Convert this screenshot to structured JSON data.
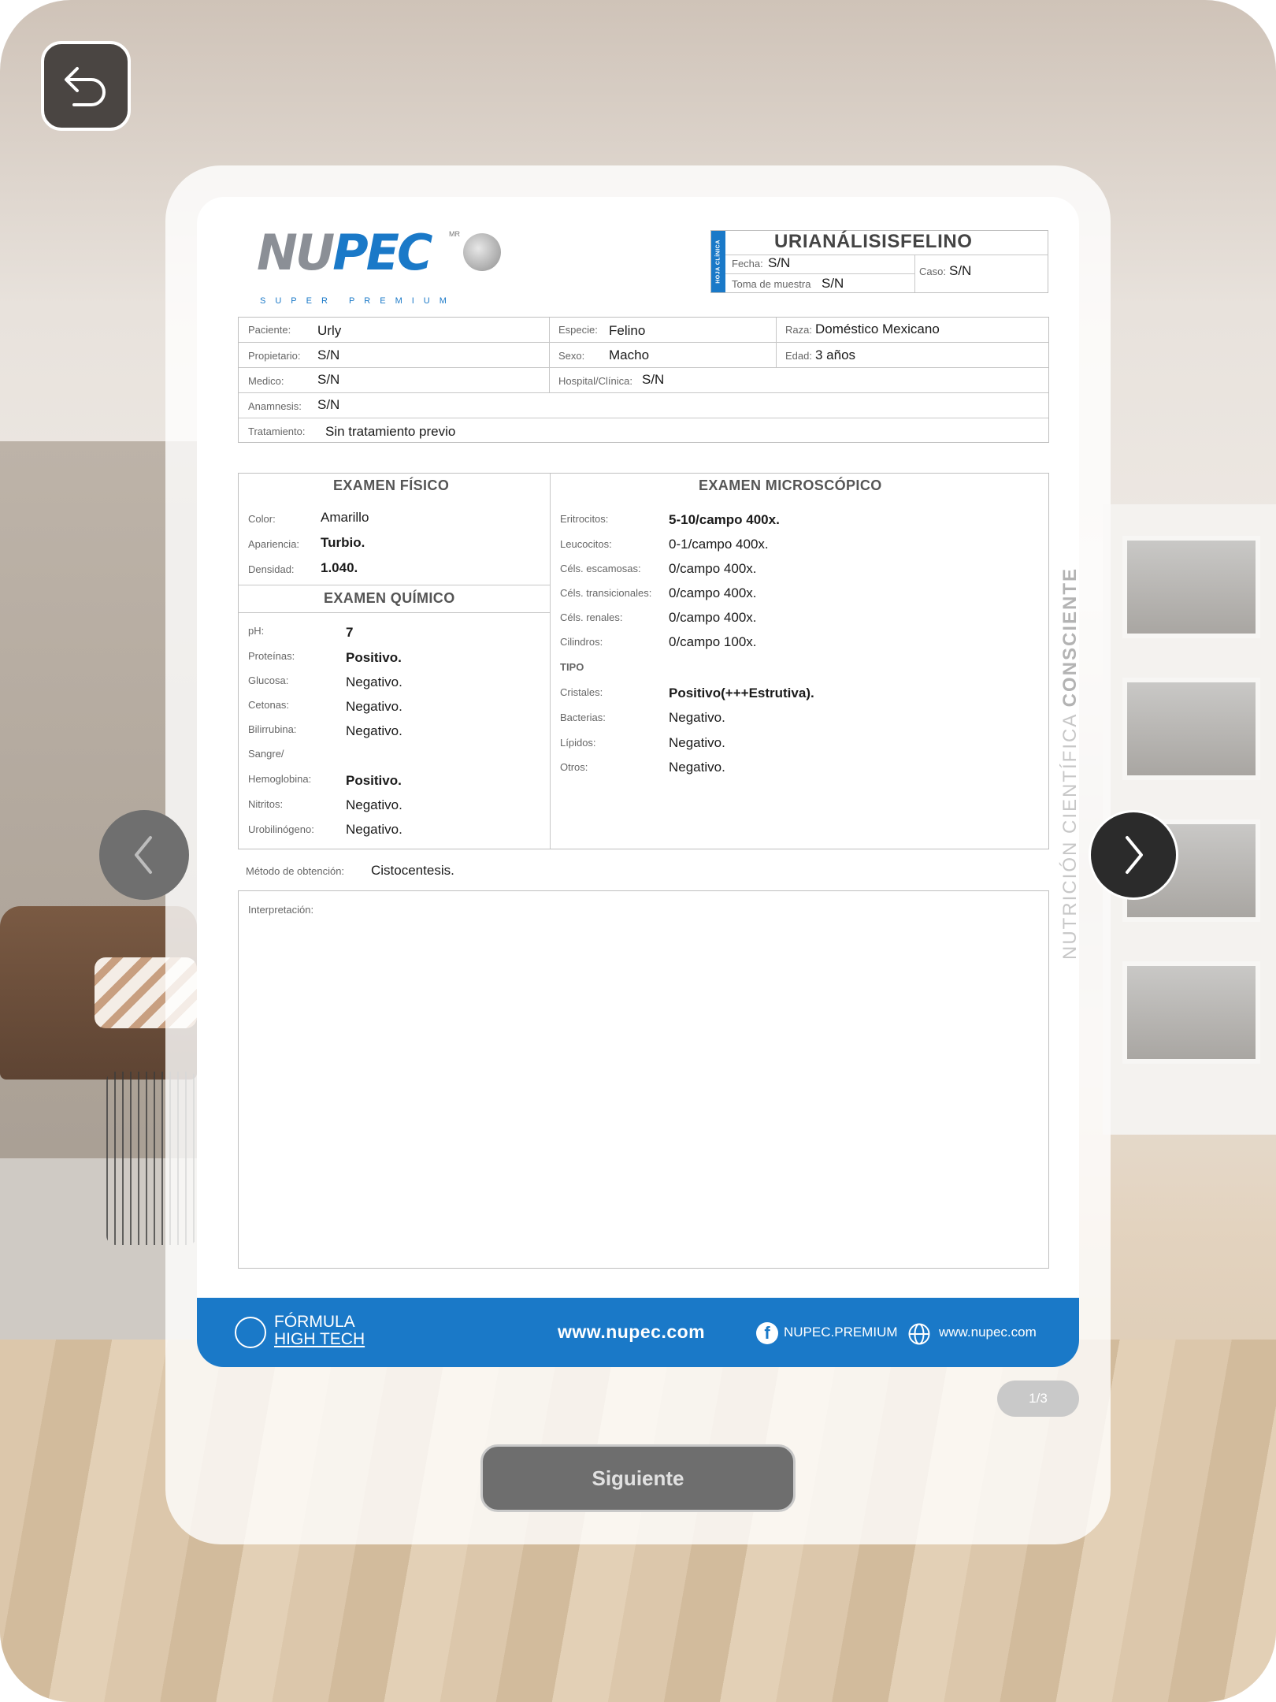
{
  "document": {
    "brand": {
      "name_part1": "NU",
      "name_part2": "PEC",
      "mark": "MR",
      "tagline": "SUPER PREMIUM"
    },
    "header": {
      "hoja_label": "HOJA CLÍNICA",
      "title": "URIANÁLISISFELINO",
      "fecha_label": "Fecha:",
      "fecha_value": "S/N",
      "toma_label": "Toma de muestra",
      "toma_value": "S/N",
      "caso_label": "Caso:",
      "caso_value": "S/N"
    },
    "patient": {
      "paciente_label": "Paciente:",
      "paciente_value": "Urly",
      "especie_label": "Especie:",
      "especie_value": "Felino",
      "raza_label": "Raza:",
      "raza_value": "Doméstico Mexicano",
      "propietario_label": "Propietario:",
      "propietario_value": "S/N",
      "sexo_label": "Sexo:",
      "sexo_value": "Macho",
      "edad_label": "Edad:",
      "edad_value": "3 años",
      "medico_label": "Medico:",
      "medico_value": "S/N",
      "hospital_label": "Hospital/Clínica:",
      "hospital_value": "S/N",
      "anamnesis_label": "Anamnesis:",
      "anamnesis_value": "S/N",
      "tratamiento_label": "Tratamiento:",
      "tratamiento_value": "Sin tratamiento previo"
    },
    "fisico": {
      "title": "EXAMEN FÍSICO",
      "rows": [
        {
          "label": "Color:",
          "value": "Amarillo"
        },
        {
          "label": "Apariencia:",
          "value": "Turbio."
        },
        {
          "label": "Densidad:",
          "value": "1.040."
        }
      ]
    },
    "quimico": {
      "title": "EXAMEN QUÍMICO",
      "rows": [
        {
          "label": "pH:",
          "value": "7"
        },
        {
          "label": "Proteínas:",
          "value": "Positivo."
        },
        {
          "label": "Glucosa:",
          "value": "Negativo."
        },
        {
          "label": "Cetonas:",
          "value": "Negativo."
        },
        {
          "label": "Bilirrubina:",
          "value": "Negativo."
        },
        {
          "label": "Sangre/",
          "value": ""
        },
        {
          "label": "Hemoglobina:",
          "value": "Positivo."
        },
        {
          "label": "Nitritos:",
          "value": "Negativo."
        },
        {
          "label": "Urobilinógeno:",
          "value": "Negativo."
        }
      ]
    },
    "microscopico": {
      "title": "EXAMEN MICROSCÓPICO",
      "rows": [
        {
          "label": "Eritrocitos:",
          "value": "5-10/campo 400x."
        },
        {
          "label": "Leucocitos:",
          "value": "0-1/campo 400x."
        },
        {
          "label": "Céls. escamosas:",
          "value": "0/campo 400x."
        },
        {
          "label": "Céls. transicionales:",
          "value": "0/campo 400x."
        },
        {
          "label": "Céls. renales:",
          "value": "0/campo 400x."
        },
        {
          "label": "Cilindros:",
          "value": "0/campo 100x."
        },
        {
          "label": "TIPO",
          "value": ""
        },
        {
          "label": "Cristales:",
          "value": "Positivo(+++Estrutiva)."
        },
        {
          "label": "Bacterias:",
          "value": "Negativo."
        },
        {
          "label": "Lípidos:",
          "value": "Negativo."
        },
        {
          "label": "Otros:",
          "value": "Negativo."
        }
      ]
    },
    "metodo_label": "Método de obtención:",
    "metodo_value": "Cistocentesis.",
    "interpretacion_label": "Interpretación:",
    "footer": {
      "formula_line1": "FÓRMULA",
      "formula_line2": "HIGH TECH",
      "website_main": "www.nupec.com",
      "facebook": "NUPEC.PREMIUM",
      "website_small": "www.nupec.com"
    }
  },
  "side_text": {
    "part1": "NUTRICIÓN CIENTÍFICA ",
    "part2": "CONSCIENTE"
  },
  "page_indicator": "1/3",
  "next_button_label": "Siguiente",
  "colors": {
    "brand_blue": "#1a79c8",
    "button_gray": "#6e6e6e"
  },
  "icons": {
    "back": "back-arrow-icon",
    "prev": "chevron-left-icon",
    "next": "chevron-right-icon",
    "facebook": "facebook-icon",
    "globe": "globe-icon"
  }
}
